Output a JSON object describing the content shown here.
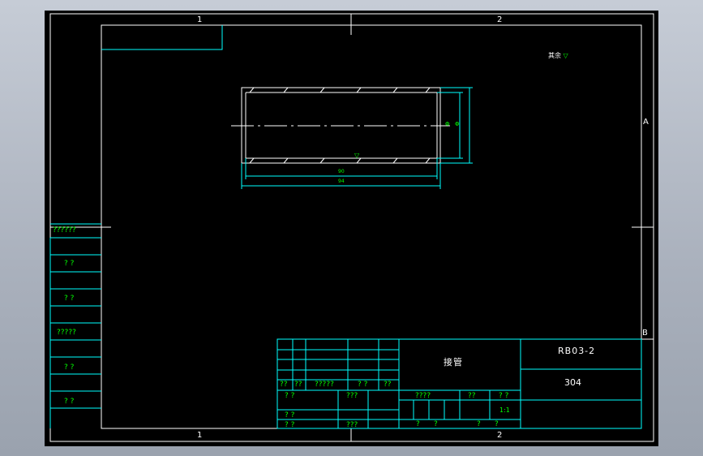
{
  "colors": {
    "frame": "#ffffff",
    "cyan": "#00ffff",
    "green": "#00ff00",
    "paper": "#000000",
    "workspace": "#b4bac4"
  },
  "zones": {
    "top_1": "1",
    "top_2": "2",
    "bottom_1": "1",
    "bottom_2": "2",
    "right_a": "A",
    "right_b": "B"
  },
  "note": "其余",
  "note_symbol": "▽",
  "dims": {
    "diameter_inner": "Φ",
    "diameter_outer": "Φ",
    "length_inner": "90",
    "length_outer": "94",
    "surface": "▽"
  },
  "left_strip": [
    "??????",
    "? ?",
    "? ?",
    "?????",
    "? ?",
    "? ?"
  ],
  "title_block": {
    "drawing_no": "RB03-2",
    "part_name": "接管",
    "material": "304",
    "rev_labels": [
      "??",
      "??",
      "?????",
      "? ?",
      "??"
    ],
    "designer_rows": [
      "? ?",
      "? ?",
      "? ?"
    ],
    "std_label": "???",
    "date_label": "???",
    "stage_label": "????",
    "weight_label": "??",
    "scale_label": "? ?",
    "scale_value": "1:1",
    "sheet_labels": [
      "?",
      "?",
      "?",
      "?"
    ]
  }
}
